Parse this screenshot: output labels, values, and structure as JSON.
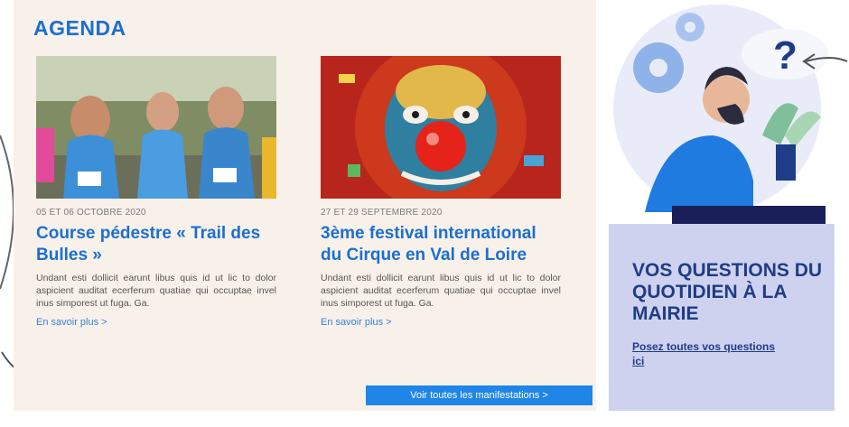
{
  "agenda": {
    "title": "AGENDA",
    "events": [
      {
        "date": "05 ET 06 OCTOBRE 2020",
        "title": "Course pédestre « Trail des Bulles »",
        "description": "Undant esti dollicit earunt libus quis id ut lic to dolor aspicient auditat ecerferum quatiae qui occuptae invel inus simporest ut fuga. Ga.",
        "more": "En savoir plus  >",
        "image_icon": "runners-photo"
      },
      {
        "date": "27 ET 29 SEPTEMBRE 2020",
        "title_prefix": "3ème festival international du Cirque en Val de Loire",
        "description": "Undant esti dollicit earunt libus quis id ut lic to dolor aspicient auditat ecerferum quatiae qui occuptae invel inus simporest ut fuga. Ga.",
        "more": "En savoir plus  >",
        "image_icon": "clown-photo"
      }
    ],
    "all_button": "Voir toutes les manifestations  >"
  },
  "sidebar": {
    "title": "VOS QUESTIONS DU QUOTIDIEN À LA MAIRIE",
    "link": "Posez toutes vos questions ici",
    "illustration_icon": "thinking-person-illustration"
  },
  "colors": {
    "accent": "#1c6fd0",
    "panel_bg": "#f8f1ea",
    "sidebar_box": "#cfd2ee",
    "sidebar_text": "#1f3c88",
    "button": "#1f86e8"
  }
}
